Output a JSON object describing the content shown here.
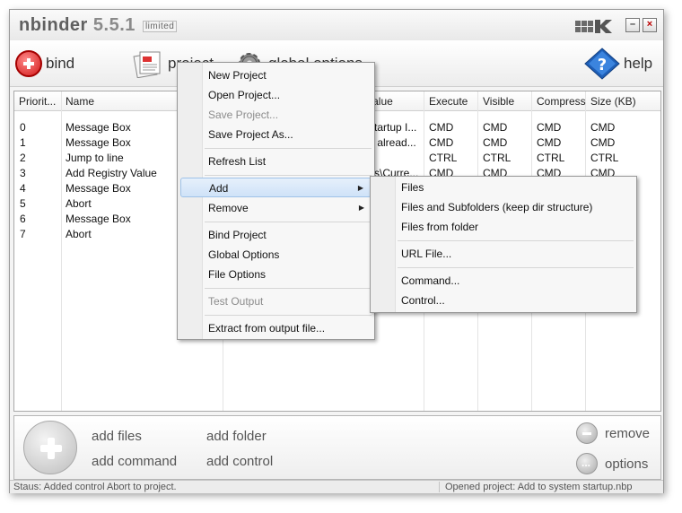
{
  "app": {
    "name": "nbinder",
    "version": "5.5.1",
    "edition": "limited"
  },
  "window_buttons": {
    "minimize": "–",
    "close": "×"
  },
  "toolbar": {
    "bind_label": "bind",
    "project_label": "project",
    "global_options_label": "global options",
    "help_label": "help"
  },
  "grid": {
    "columns": [
      "Priorit...",
      "Name",
      "Value",
      "Execute",
      "Visible",
      "Compress",
      "Size (KB)"
    ],
    "rows": [
      {
        "priority": "0",
        "name": "Message Box",
        "value": "startup I...",
        "execute": "CMD",
        "visible": "CMD",
        "compress": "CMD",
        "size": "CMD"
      },
      {
        "priority": "1",
        "name": "Message Box",
        "value": "y alread...",
        "execute": "CMD",
        "visible": "CMD",
        "compress": "CMD",
        "size": "CMD"
      },
      {
        "priority": "2",
        "name": "Jump to line",
        "value": "",
        "execute": "CTRL",
        "visible": "CTRL",
        "compress": "CTRL",
        "size": "CTRL"
      },
      {
        "priority": "3",
        "name": "Add Registry Value",
        "value": "vs\\Curre...",
        "execute": "CMD",
        "visible": "CMD",
        "compress": "CMD",
        "size": "CMD"
      },
      {
        "priority": "4",
        "name": "Message Box",
        "value": "",
        "execute": "",
        "visible": "",
        "compress": "",
        "size": ""
      },
      {
        "priority": "5",
        "name": "Abort",
        "value": "",
        "execute": "",
        "visible": "",
        "compress": "",
        "size": ""
      },
      {
        "priority": "6",
        "name": "Message Box",
        "value": "",
        "execute": "",
        "visible": "",
        "compress": "",
        "size": ""
      },
      {
        "priority": "7",
        "name": "Abort",
        "value": "",
        "execute": "",
        "visible": "",
        "compress": "",
        "size": ""
      }
    ]
  },
  "context_menu": {
    "items": [
      {
        "label": "New Project",
        "disabled": false
      },
      {
        "label": "Open Project...",
        "disabled": false
      },
      {
        "label": "Save Project...",
        "disabled": true
      },
      {
        "label": "Save Project As...",
        "disabled": false
      },
      {
        "label": "Refresh List",
        "disabled": false
      },
      {
        "label": "Add",
        "disabled": false
      },
      {
        "label": "Remove",
        "disabled": false
      },
      {
        "label": "Bind Project",
        "disabled": false
      },
      {
        "label": "Global Options",
        "disabled": false
      },
      {
        "label": "File Options",
        "disabled": false
      },
      {
        "label": "Test Output",
        "disabled": true
      },
      {
        "label": "Extract from output file...",
        "disabled": false
      }
    ]
  },
  "add_submenu": {
    "items": [
      {
        "label": "Files"
      },
      {
        "label": "Files and Subfolders (keep dir structure)"
      },
      {
        "label": "Files from folder"
      },
      {
        "label": "URL File..."
      },
      {
        "label": "Command..."
      },
      {
        "label": "Control..."
      }
    ]
  },
  "bottom_panel": {
    "add_files": "add files",
    "add_folder": "add folder",
    "add_command": "add command",
    "add_control": "add control",
    "remove": "remove",
    "options": "options"
  },
  "status": {
    "left": "Staus: Added control Abort to project.",
    "right": "Opened project: Add to system startup.nbp"
  },
  "colors": {
    "bind_accent": "#d21818",
    "help_accent": "#1e5fb8",
    "menu_highlight": "#cfe2f8"
  }
}
